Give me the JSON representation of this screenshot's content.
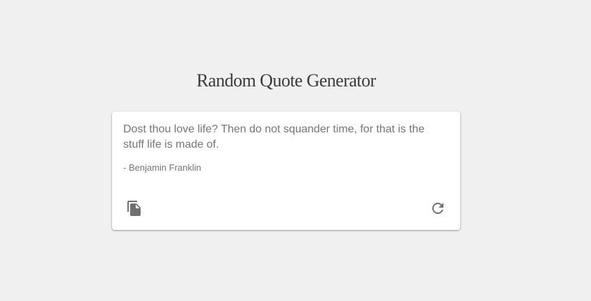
{
  "header": {
    "title": "Random Quote Generator"
  },
  "quote": {
    "text": "Dost thou love life? Then do not squander time, for that is the stuff life is made of.",
    "author": "- Benjamin Franklin"
  },
  "actions": {
    "copy_icon": "copy-icon",
    "refresh_icon": "refresh-icon"
  },
  "colors": {
    "background": "#f0f0f0",
    "card": "#ffffff",
    "text": "#757575",
    "title": "#3a3a3a"
  }
}
